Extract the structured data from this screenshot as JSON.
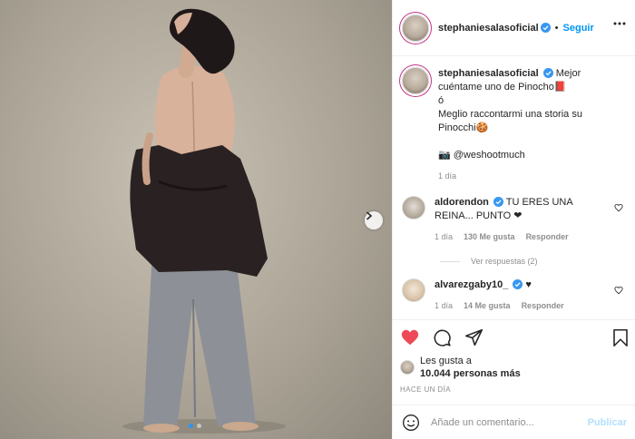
{
  "post": {
    "author": "stephaniesalasoficial",
    "follow_label": "Seguir",
    "separator": "•",
    "photo_alt": "Post photo"
  },
  "caption": {
    "username": "stephaniesalasoficial",
    "line1": "Mejor cuéntame uno de Pinocho📕",
    "line2": "ó",
    "line3": "Meglio raccontarmi una storia su Pinocchi🍪",
    "credit": "📷 @weshootmuch",
    "time": "1 día"
  },
  "comments": [
    {
      "username": "aldorendon",
      "text": "TU ERES UNA REINA... PUNTO ❤",
      "time": "1 día",
      "likes": "130 Me gusta",
      "reply_label": "Responder",
      "view_replies": "Ver respuestas (2)"
    },
    {
      "username": "alvarezgaby10_",
      "text": "♥",
      "time": "1 día",
      "likes": "14 Me gusta",
      "reply_label": "Responder"
    }
  ],
  "actions": {
    "liked_by_prefix": "Les gusta a",
    "likes_count": "10.044 personas más",
    "timestamp": "HACE UN DÍA"
  },
  "comment_box": {
    "placeholder": "Añade un comentario...",
    "publish_label": "Publicar"
  },
  "colors": {
    "accent": "#0095f6",
    "like_red": "#ed4956",
    "verified": "#3897f0"
  },
  "carousel": {
    "total": 2,
    "current": 1
  }
}
